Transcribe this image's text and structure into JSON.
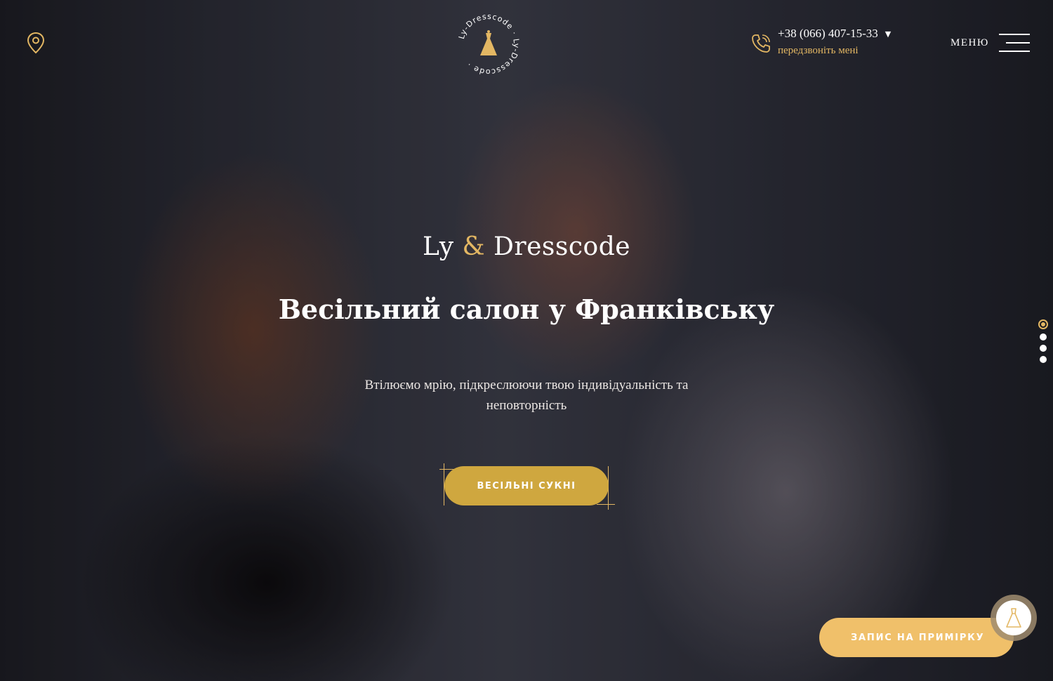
{
  "header": {
    "location_icon": "map-pin-icon",
    "logo_text": "Ly-Dresscode",
    "phone": "+38 (066) 407-15-33",
    "callback_label": "передзвоніть мені",
    "menu_label": "МЕНЮ"
  },
  "hero": {
    "brand_left": "Ly",
    "brand_amp": "&",
    "brand_right": "Dresscode",
    "title": "Весільний салон у Франківську",
    "subtitle": "Втілюємо мрію, підкреслюючи твою індивідуальність та неповторність",
    "cta_label": "ВЕСІЛЬНІ СУКНІ"
  },
  "slider": {
    "slides": 4,
    "active": 1
  },
  "fitting": {
    "label": "ЗАПИС НА ПРИМІРКУ",
    "icon": "dress-icon"
  },
  "colors": {
    "accent": "#e3b763",
    "cta": "#cfa73f",
    "fitting": "#f0c06a"
  }
}
